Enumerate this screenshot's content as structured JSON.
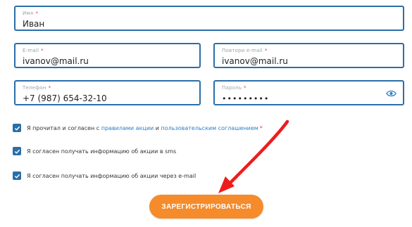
{
  "form": {
    "name": {
      "label": "Имя",
      "required": "*",
      "value": "Иван"
    },
    "email": {
      "label": "E-mail",
      "required": "*",
      "value": "ivanov@mail.ru"
    },
    "email_repeat": {
      "label": "Повтори e-mail",
      "required": "*",
      "value": "ivanov@mail.ru"
    },
    "phone": {
      "label": "Телефон",
      "required": "*",
      "value": "+7 (987) 654-32-10"
    },
    "password": {
      "label": "Пароль",
      "required": "*",
      "value": "•••••••••",
      "icon": "eye-icon"
    }
  },
  "consents": [
    {
      "checked": true,
      "text_before": "Я прочитал и согласен с ",
      "link1": "правилами акции",
      "text_mid": " и ",
      "link2": "пользовательским соглашением",
      "required": "*"
    },
    {
      "checked": true,
      "text": "Я согласен получать информацию об акции в sms"
    },
    {
      "checked": true,
      "text": "Я согласен получать информацию об акции через e-mail"
    }
  ],
  "submit_label": "ЗАРЕГИСТРИРОВАТЬСЯ",
  "colors": {
    "accent_blue": "#2b6ea8",
    "link": "#2b7fc4",
    "button": "#f58b2b",
    "annotation_arrow": "#ee1c1c"
  }
}
